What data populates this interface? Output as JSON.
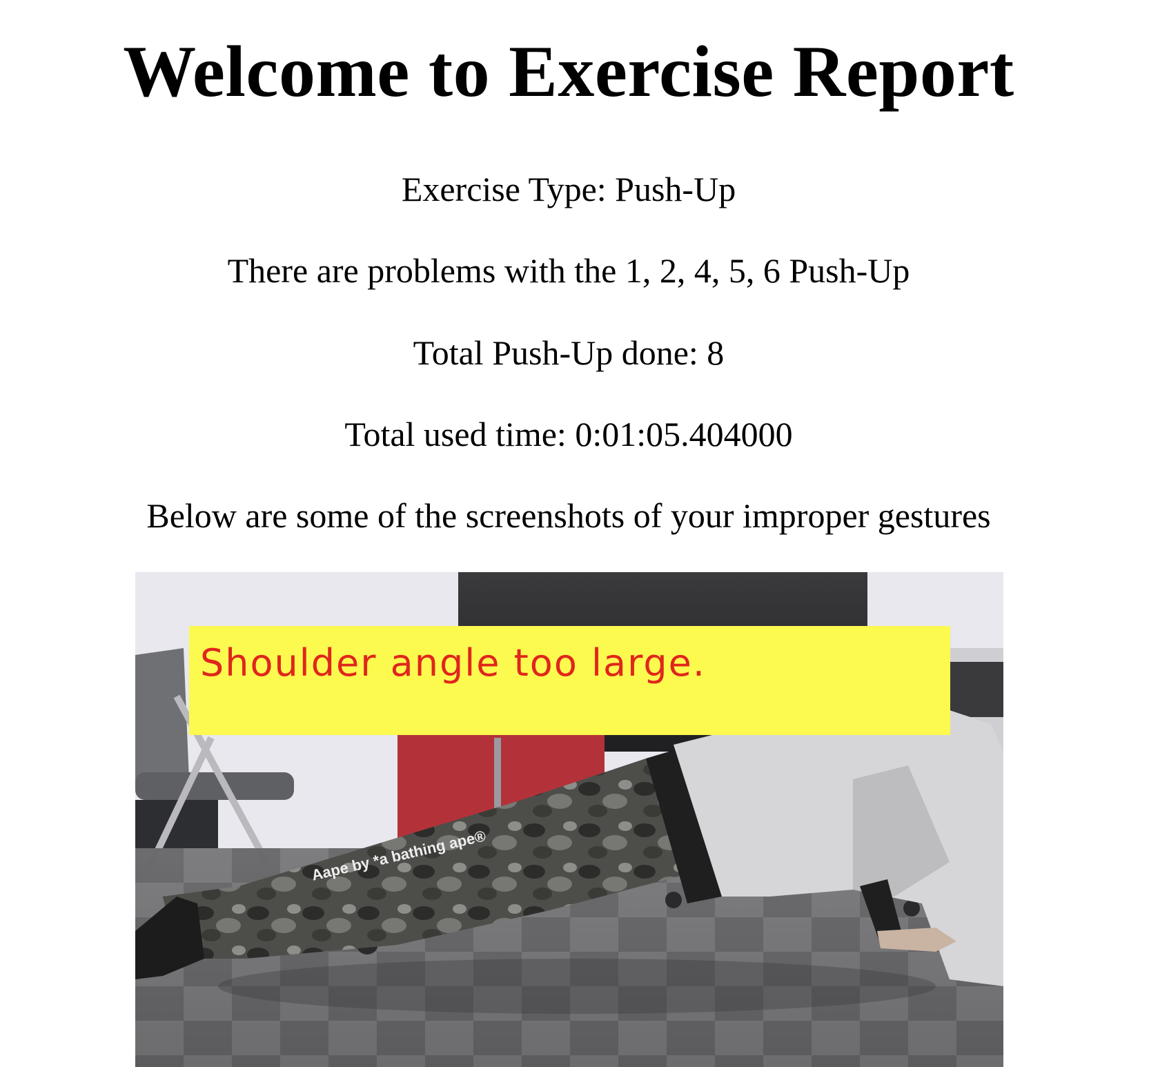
{
  "report": {
    "title": "Welcome to Exercise Report",
    "exercise_type": "Exercise Type: Push-Up",
    "problems": "There are problems with the 1, 2, 4, 5, 6 Push-Up",
    "total_done": "Total Push-Up done: 8",
    "total_time": "Total used time: 0:01:05.404000",
    "screenshots_intro": "Below are some of the screenshots of your improper gestures"
  },
  "screenshot": {
    "alert_text": "Shoulder angle too large.",
    "brand_text": "Aape by *a bathing ape®",
    "alert_background": "#fcf94f",
    "alert_color": "#e0261c"
  }
}
